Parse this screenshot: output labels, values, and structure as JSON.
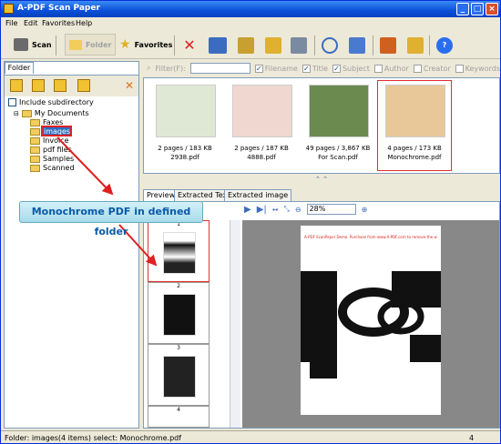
{
  "window": {
    "title": "A-PDF Scan Paper"
  },
  "menu": [
    "File",
    "Edit",
    "Favorites",
    "Help"
  ],
  "toolbar": {
    "scan": "Scan",
    "folder": "Folder",
    "favorites": "Favorites"
  },
  "left": {
    "tab": "Folder",
    "include_subdir": "Include subdirectory",
    "tree": {
      "root": "My Documents",
      "children": [
        "Faxes",
        "images",
        "Invoice",
        "pdf files",
        "Samples",
        "Scanned"
      ]
    }
  },
  "filter": {
    "label": "Filter(F):",
    "checks": [
      {
        "label": "Filename",
        "on": true
      },
      {
        "label": "Title",
        "on": true
      },
      {
        "label": "Subject",
        "on": true
      },
      {
        "label": "Author",
        "on": false
      },
      {
        "label": "Creator",
        "on": false
      },
      {
        "label": "Keywords",
        "on": false
      }
    ]
  },
  "files": [
    {
      "info": "2 pages / 183 KB",
      "name": "2938.pdf"
    },
    {
      "info": "2 pages / 187 KB",
      "name": "4888.pdf"
    },
    {
      "info": "49 pages / 3,867 KB",
      "name": "For Scan.pdf"
    },
    {
      "info": "4 pages / 173 KB",
      "name": "Monochrome.pdf"
    }
  ],
  "tabs": [
    "Preview",
    "Extracted Text",
    "Extracted image"
  ],
  "zoom": "28%",
  "pages": [
    "1",
    "2",
    "3",
    "4"
  ],
  "doc": {
    "watermark": "A-PDF ScanPaper Demo. Purchase from www.A-PDF.com to remove the w"
  },
  "status": {
    "text": "Folder: images(4 items) select: Monochrome.pdf",
    "page": "4"
  },
  "callout": "Monochrome PDF in defined folder",
  "colors": {
    "titlebar": "#0a4fd8",
    "accent": "#e02020",
    "callout_text": "#0a5aa8"
  }
}
